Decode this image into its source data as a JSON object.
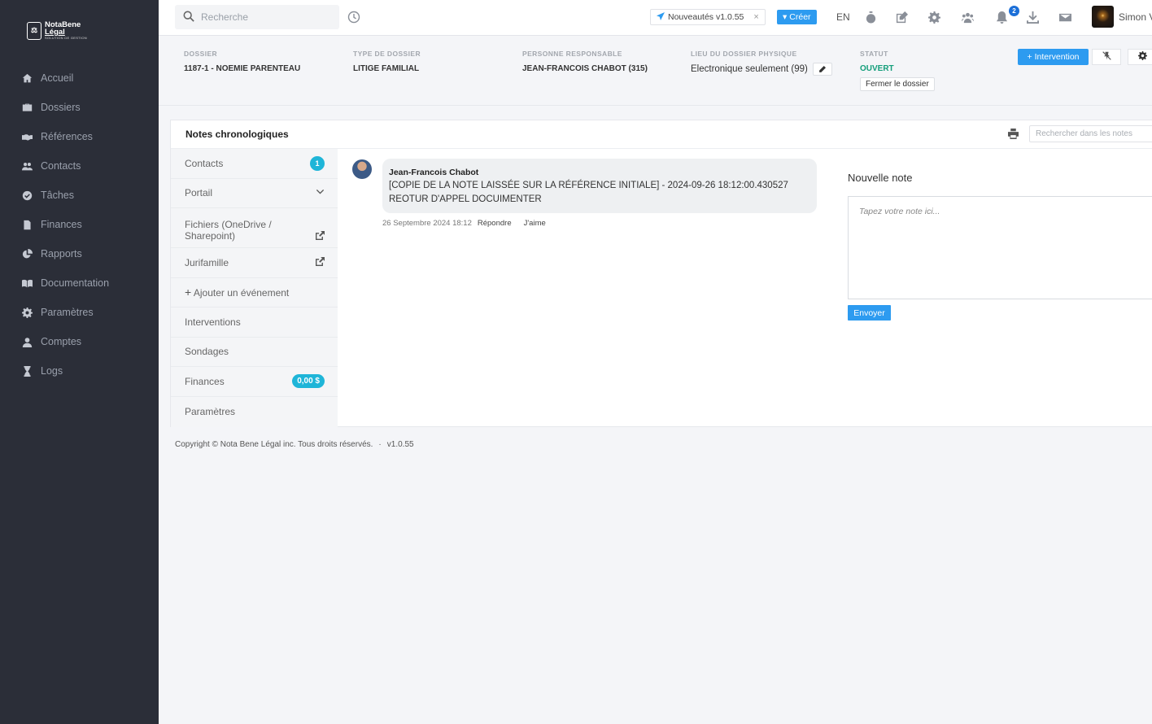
{
  "brand": {
    "name_line1": "NotaBene",
    "name_line2": "Légal",
    "tagline": "SOLUTION DE GESTION"
  },
  "sidebar": {
    "items": [
      {
        "label": "Accueil",
        "icon": "home-icon"
      },
      {
        "label": "Dossiers",
        "icon": "briefcase-icon"
      },
      {
        "label": "Références",
        "icon": "handshake-icon"
      },
      {
        "label": "Contacts",
        "icon": "users-icon"
      },
      {
        "label": "Tâches",
        "icon": "check-circle-icon"
      },
      {
        "label": "Finances",
        "icon": "file-invoice-icon"
      },
      {
        "label": "Rapports",
        "icon": "pie-chart-icon"
      },
      {
        "label": "Documentation",
        "icon": "book-icon"
      },
      {
        "label": "Paramètres",
        "icon": "gear-icon"
      },
      {
        "label": "Comptes",
        "icon": "user-icon"
      },
      {
        "label": "Logs",
        "icon": "hourglass-icon"
      }
    ]
  },
  "topbar": {
    "search_placeholder": "Recherche",
    "news_label": "Nouveautés v1.0.55",
    "news_close": "×",
    "create_label": "Créer",
    "language": "EN",
    "notification_count": "2",
    "username": "Simon V"
  },
  "dossier": {
    "dossier_label": "DOSSIER",
    "dossier_value": "1187-1 - NOEMIE PARENTEAU",
    "type_label": "TYPE DE DOSSIER",
    "type_value": "LITIGE FAMILIAL",
    "responsible_label": "PERSONNE RESPONSABLE",
    "responsible_value": "JEAN-FRANCOIS CHABOT (315)",
    "location_label": "LIEU DU DOSSIER PHYSIQUE",
    "location_value": "Electronique seulement (99)",
    "status_label": "STATUT",
    "status_value": "OUVERT",
    "close_label": "Fermer le dossier",
    "intervention_label": "Intervention"
  },
  "notes": {
    "title": "Notes chronologiques",
    "search_placeholder": "Rechercher dans les notes",
    "subnav": {
      "contacts": "Contacts",
      "contacts_count": "1",
      "portail": "Portail",
      "fichiers": "Fichiers (OneDrive / Sharepoint)",
      "jurifamille": "Jurifamille",
      "add_event": "Ajouter un événement",
      "interventions": "Interventions",
      "sondages": "Sondages",
      "finances": "Finances",
      "finances_amount": "0,00 $",
      "parametres": "Paramètres"
    },
    "note": {
      "author": "Jean-Francois Chabot",
      "line1": "[COPIE DE LA NOTE LAISSÉE SUR LA RÉFÉRENCE INITIALE] - 2024-09-26 18:12:00.430527",
      "line2": "REOTUR D'APPEL DOCUIMENTER",
      "date": "26 Septembre 2024 18:12",
      "reply": "Répondre",
      "like": "J'aime"
    },
    "new_note_title": "Nouvelle note",
    "new_note_placeholder": "Tapez votre note ici...",
    "send_label": "Envoyer"
  },
  "footer": {
    "copyright": "Copyright © Nota Bene Légal inc. Tous droits réservés.",
    "separator": "·",
    "version": "v1.0.55"
  },
  "colors": {
    "sidebar_bg": "#2b2e38",
    "accent_blue": "#2d9bf0",
    "badge_cyan": "#1fb5d8",
    "status_green": "#139e7a"
  }
}
